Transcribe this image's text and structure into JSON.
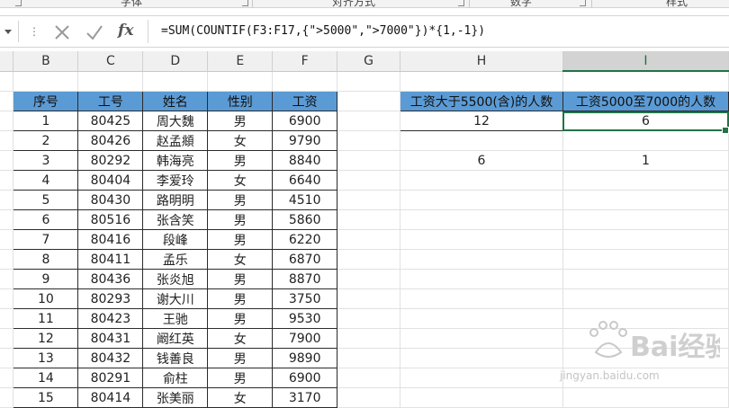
{
  "ribbon": {
    "groups": [
      "字体",
      "对齐方式",
      "数字",
      "样式"
    ]
  },
  "formula_bar": {
    "formula": "=SUM(COUNTIF(F3:F17,{\">5000\",\">7000\"})*{1,-1})"
  },
  "sheet": {
    "columns": [
      "B",
      "C",
      "D",
      "E",
      "F",
      "G",
      "H",
      "I"
    ],
    "selected_column": "I",
    "table": {
      "headers": [
        "序号",
        "工号",
        "姓名",
        "性别",
        "工资"
      ],
      "rows": [
        [
          "1",
          "80425",
          "周大魏",
          "男",
          "6900"
        ],
        [
          "2",
          "80426",
          "赵孟頫",
          "女",
          "9790"
        ],
        [
          "3",
          "80292",
          "韩海亮",
          "男",
          "8840"
        ],
        [
          "4",
          "80404",
          "李爱玲",
          "女",
          "6640"
        ],
        [
          "5",
          "80430",
          "路明明",
          "男",
          "4510"
        ],
        [
          "6",
          "80516",
          "张含笑",
          "男",
          "5860"
        ],
        [
          "7",
          "80416",
          "段峰",
          "男",
          "6220"
        ],
        [
          "8",
          "80411",
          "孟乐",
          "女",
          "6870"
        ],
        [
          "9",
          "80436",
          "张炎旭",
          "男",
          "8870"
        ],
        [
          "10",
          "80293",
          "谢大川",
          "男",
          "3750"
        ],
        [
          "11",
          "80423",
          "王驰",
          "男",
          "9530"
        ],
        [
          "12",
          "80431",
          "阚红英",
          "女",
          "7900"
        ],
        [
          "13",
          "80432",
          "钱善良",
          "男",
          "9890"
        ],
        [
          "14",
          "80291",
          "俞柱",
          "男",
          "6900"
        ],
        [
          "15",
          "80414",
          "张美丽",
          "女",
          "3170"
        ]
      ]
    },
    "summary": {
      "h_header": "工资大于5500(含)的人数",
      "i_header": "工资5000至7000的人数",
      "h_value": "12",
      "i_value": "6",
      "h_extra": "6",
      "i_extra": "1"
    }
  },
  "watermark": {
    "brand": "Bai经验",
    "url": "jingyan.baidu.com"
  }
}
